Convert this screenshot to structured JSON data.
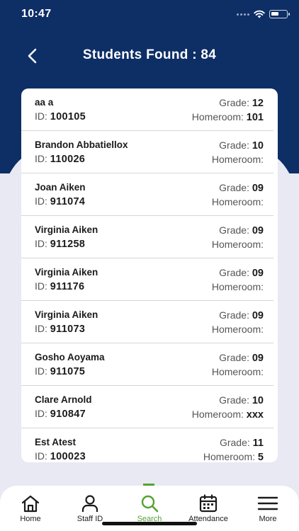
{
  "status": {
    "time": "10:47"
  },
  "header": {
    "title": "Students Found : 84"
  },
  "labels": {
    "grade": "Grade:",
    "id": "ID:",
    "homeroom": "Homeroom:"
  },
  "students": [
    {
      "name": "aa a",
      "id": "100105",
      "grade": "12",
      "homeroom": "101"
    },
    {
      "name": "Brandon Abbatiellox",
      "id": "110026",
      "grade": "10",
      "homeroom": ""
    },
    {
      "name": "Joan Aiken",
      "id": "911074",
      "grade": "09",
      "homeroom": ""
    },
    {
      "name": "Virginia Aiken",
      "id": "911258",
      "grade": "09",
      "homeroom": ""
    },
    {
      "name": "Virginia Aiken",
      "id": "911176",
      "grade": "09",
      "homeroom": ""
    },
    {
      "name": "Virginia Aiken",
      "id": "911073",
      "grade": "09",
      "homeroom": ""
    },
    {
      "name": "Gosho Aoyama",
      "id": "911075",
      "grade": "09",
      "homeroom": ""
    },
    {
      "name": "Clare Arnold",
      "id": "910847",
      "grade": "10",
      "homeroom": "xxx"
    },
    {
      "name": "Est Atest",
      "id": "100023",
      "grade": "11",
      "homeroom": "5"
    }
  ],
  "tabs": [
    {
      "label": "Home",
      "icon": "home-icon"
    },
    {
      "label": "Staff ID",
      "icon": "person-icon"
    },
    {
      "label": "Search",
      "icon": "search-icon",
      "active": true
    },
    {
      "label": "Attendance",
      "icon": "calendar-icon"
    },
    {
      "label": "More",
      "icon": "menu-icon"
    }
  ],
  "colors": {
    "header": "#0e2e66",
    "accent": "#55a22f",
    "background": "#e9e9f3"
  }
}
